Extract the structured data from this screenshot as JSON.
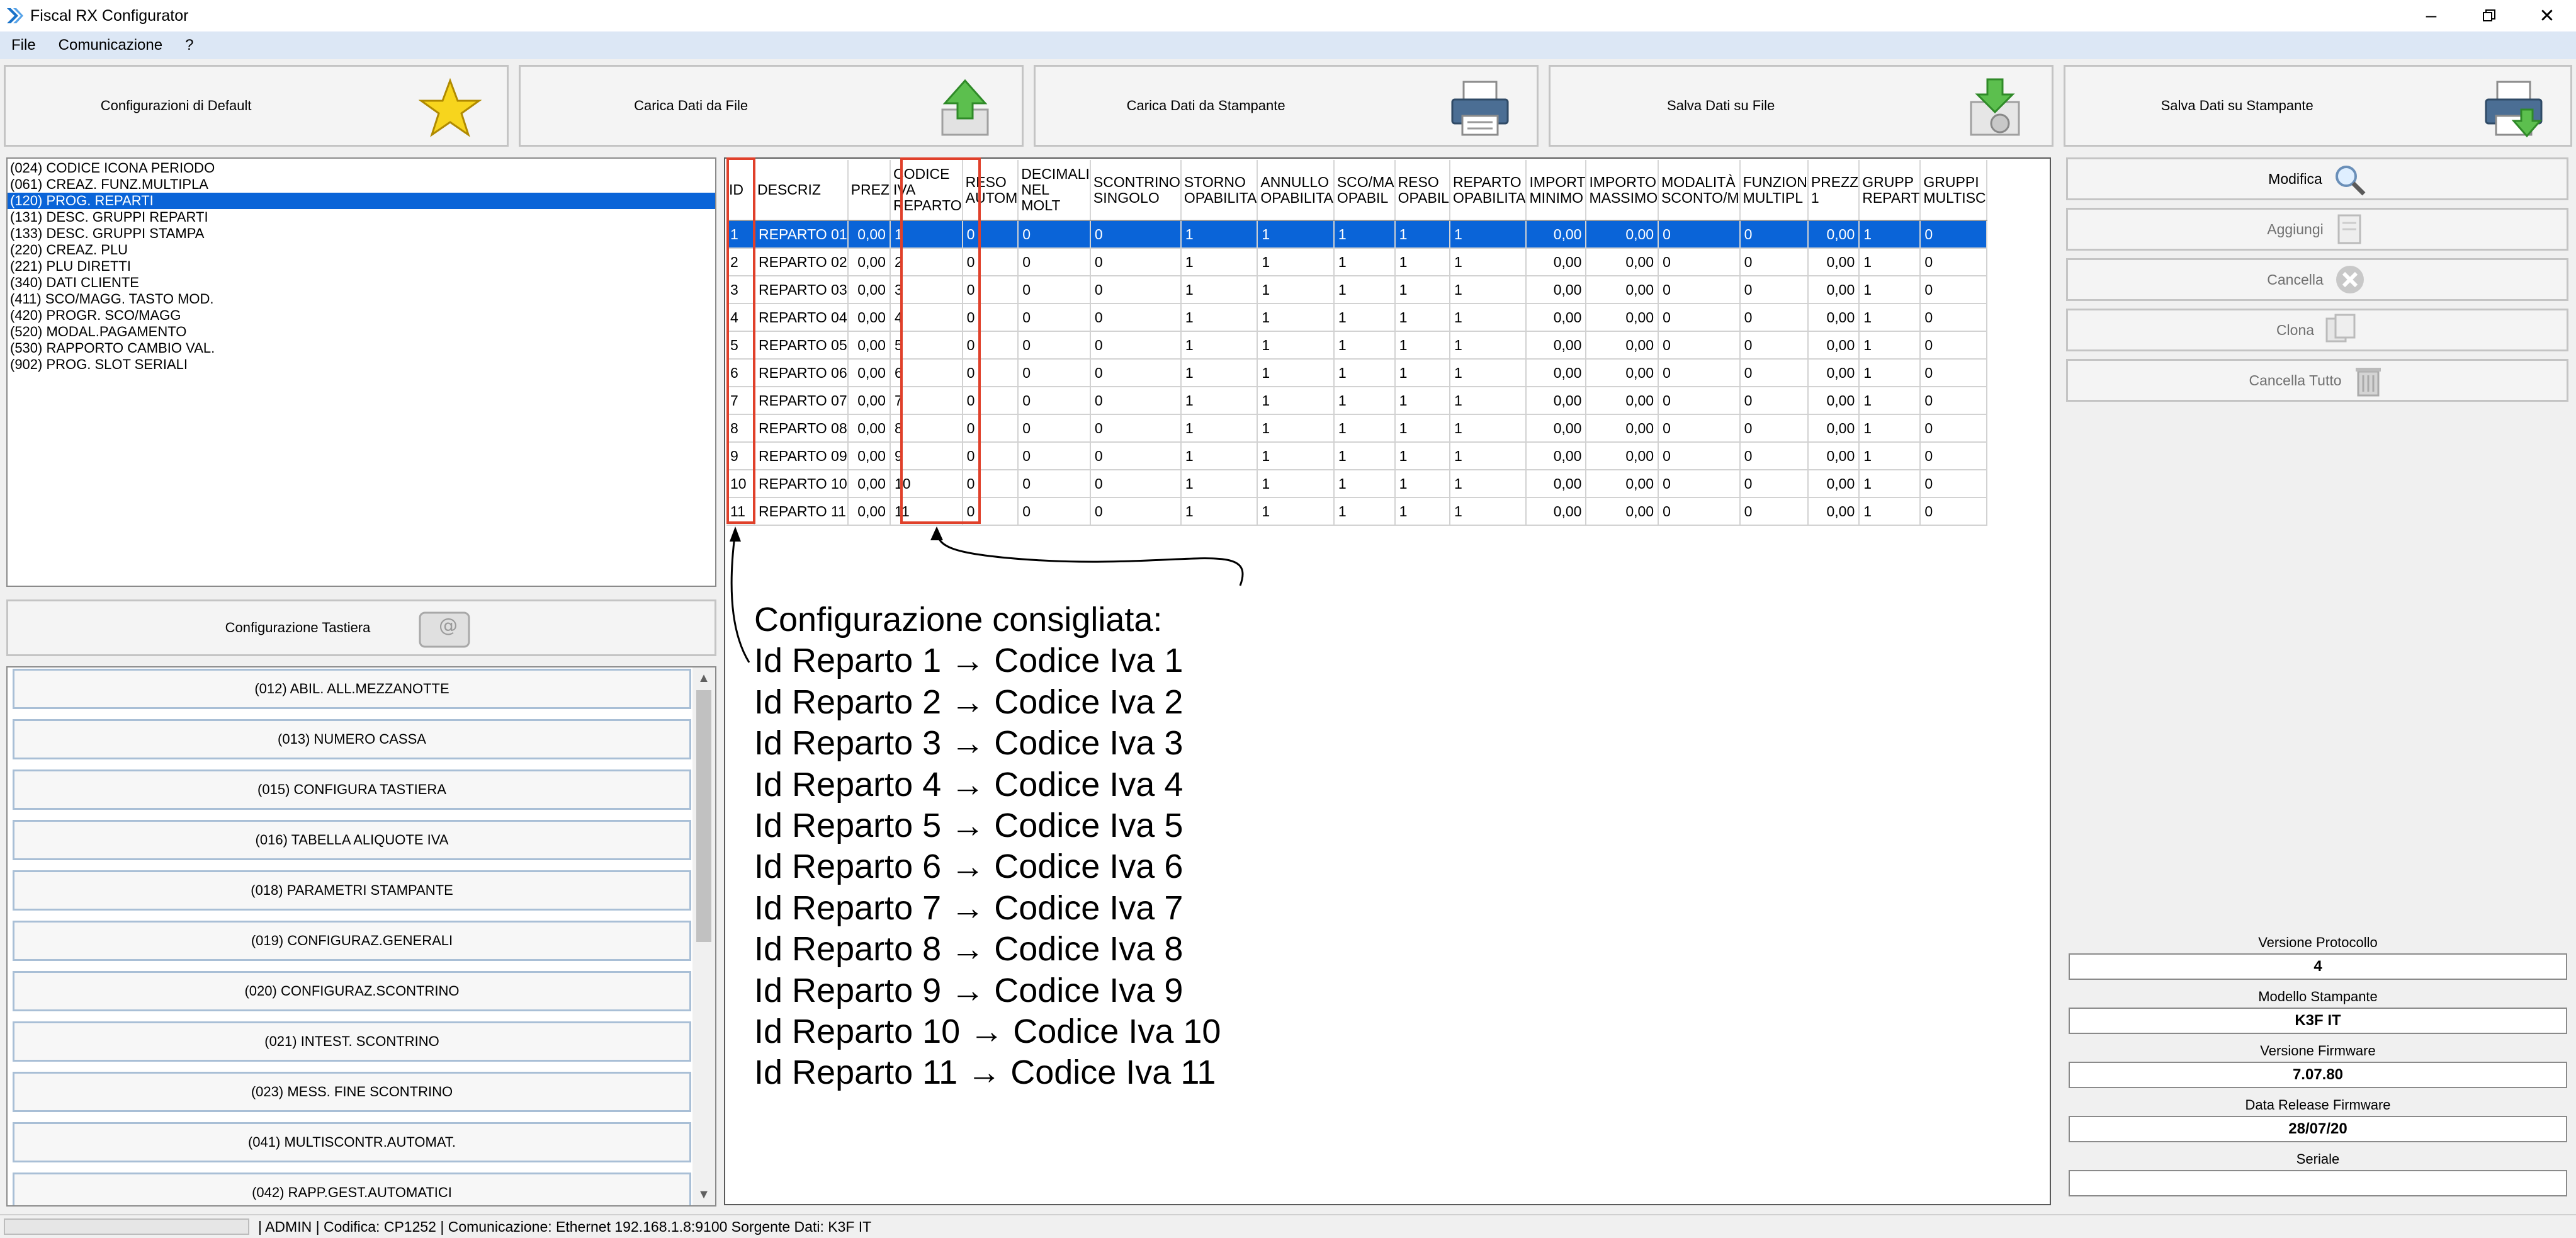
{
  "window": {
    "title": "Fiscal RX Configurator"
  },
  "menu": [
    "File",
    "Comunicazione",
    "?"
  ],
  "toolbar": [
    {
      "label": "Configurazioni di Default",
      "icon": "star-icon"
    },
    {
      "label": "Carica Dati da File",
      "icon": "upload-arrow-icon"
    },
    {
      "label": "Carica Dati da Stampante",
      "icon": "printer-icon"
    },
    {
      "label": "Salva Dati su File",
      "icon": "save-file-icon"
    },
    {
      "label": "Salva Dati su Stampante",
      "icon": "printer-save-icon"
    }
  ],
  "params_list": {
    "items": [
      "(024) CODICE ICONA PERIODO",
      "(061) CREAZ. FUNZ.MULTIPLA",
      "(120) PROG. REPARTI",
      "(131) DESC. GRUPPI REPARTI",
      "(133) DESC. GRUPPI STAMPA",
      "(220) CREAZ. PLU",
      "(221) PLU DIRETTI",
      "(340) DATI CLIENTE",
      "(411) SCO/MAGG. TASTO MOD.",
      "(420) PROGR. SCO/MAGG",
      "(520) MODAL.PAGAMENTO",
      "(530) RAPPORTO CAMBIO VAL.",
      "(902) PROG. SLOT SERIALI"
    ],
    "selected_index": 2
  },
  "keyboard_config": {
    "label": "Configurazione Tastiera",
    "items": [
      "(012) ABIL. ALL.MEZZANOTTE",
      "(013) NUMERO CASSA",
      "(015) CONFIGURA TASTIERA",
      "(016) TABELLA ALIQUOTE IVA",
      "(018) PARAMETRI STAMPANTE",
      "(019) CONFIGURAZ.GENERALI",
      "(020) CONFIGURAZ.SCONTRINO",
      "(021) INTEST. SCONTRINO",
      "(023) MESS. FINE SCONTRINO",
      "(041) MULTISCONTR.AUTOMAT.",
      "(042) RAPP.GEST.AUTOMATICI"
    ]
  },
  "grid": {
    "columns": [
      "ID",
      "DESCRIZ",
      "PREZ",
      "CODICE\nIVA\nREPARTO",
      "RESO\nAUTOM",
      "DECIMALI\nNEL MOLT",
      "SCONTRINO\nSINGOLO",
      "STORNO\nOPABILITA",
      "ANNULLO\nOPABILITA",
      "SCO/MA\nOPABIL",
      "RESO\nOPABIL",
      "REPARTO\nOPABILITA",
      "IMPORT\nMINIMO",
      "IMPORTO\nMASSIMO",
      "MODALITÀ\nSCONTO/M",
      "FUNZION\nMULTIPL",
      "PREZZ\n1",
      "GRUPP\nREPART",
      "GRUPPI\nMULTISC"
    ],
    "rows": [
      [
        "1",
        "REPARTO 01",
        "0,00",
        "1",
        "0",
        "0",
        "0",
        "1",
        "1",
        "1",
        "1",
        "1",
        "0,00",
        "0,00",
        "0",
        "0",
        "0,00",
        "1",
        "0"
      ],
      [
        "2",
        "REPARTO 02",
        "0,00",
        "2",
        "0",
        "0",
        "0",
        "1",
        "1",
        "1",
        "1",
        "1",
        "0,00",
        "0,00",
        "0",
        "0",
        "0,00",
        "1",
        "0"
      ],
      [
        "3",
        "REPARTO 03",
        "0,00",
        "3",
        "0",
        "0",
        "0",
        "1",
        "1",
        "1",
        "1",
        "1",
        "0,00",
        "0,00",
        "0",
        "0",
        "0,00",
        "1",
        "0"
      ],
      [
        "4",
        "REPARTO 04",
        "0,00",
        "4",
        "0",
        "0",
        "0",
        "1",
        "1",
        "1",
        "1",
        "1",
        "0,00",
        "0,00",
        "0",
        "0",
        "0,00",
        "1",
        "0"
      ],
      [
        "5",
        "REPARTO 05",
        "0,00",
        "5",
        "0",
        "0",
        "0",
        "1",
        "1",
        "1",
        "1",
        "1",
        "0,00",
        "0,00",
        "0",
        "0",
        "0,00",
        "1",
        "0"
      ],
      [
        "6",
        "REPARTO 06",
        "0,00",
        "6",
        "0",
        "0",
        "0",
        "1",
        "1",
        "1",
        "1",
        "1",
        "0,00",
        "0,00",
        "0",
        "0",
        "0,00",
        "1",
        "0"
      ],
      [
        "7",
        "REPARTO 07",
        "0,00",
        "7",
        "0",
        "0",
        "0",
        "1",
        "1",
        "1",
        "1",
        "1",
        "0,00",
        "0,00",
        "0",
        "0",
        "0,00",
        "1",
        "0"
      ],
      [
        "8",
        "REPARTO 08",
        "0,00",
        "8",
        "0",
        "0",
        "0",
        "1",
        "1",
        "1",
        "1",
        "1",
        "0,00",
        "0,00",
        "0",
        "0",
        "0,00",
        "1",
        "0"
      ],
      [
        "9",
        "REPARTO 09",
        "0,00",
        "9",
        "0",
        "0",
        "0",
        "1",
        "1",
        "1",
        "1",
        "1",
        "0,00",
        "0,00",
        "0",
        "0",
        "0,00",
        "1",
        "0"
      ],
      [
        "10",
        "REPARTO 10",
        "0,00",
        "10",
        "0",
        "0",
        "0",
        "1",
        "1",
        "1",
        "1",
        "1",
        "0,00",
        "0,00",
        "0",
        "0",
        "0,00",
        "1",
        "0"
      ],
      [
        "11",
        "REPARTO 11",
        "0,00",
        "11",
        "0",
        "0",
        "0",
        "1",
        "1",
        "1",
        "1",
        "1",
        "0,00",
        "0,00",
        "0",
        "0",
        "0,00",
        "1",
        "0"
      ]
    ],
    "selected_row": 0
  },
  "annotation": {
    "title": "Configurazione consigliata:",
    "lines": [
      "Id Reparto 1  → Codice Iva 1",
      "Id Reparto 2  → Codice Iva 2",
      "Id Reparto 3  → Codice Iva 3",
      "Id Reparto 4  → Codice Iva 4",
      "Id Reparto 5  → Codice Iva 5",
      "Id Reparto 6  → Codice Iva 6",
      "Id Reparto 7  → Codice Iva 7",
      "Id Reparto 8  → Codice Iva 8",
      "Id Reparto 9  → Codice Iva 9",
      "Id Reparto 10 → Codice Iva 10",
      "Id Reparto 11 → Codice Iva 11"
    ],
    "highlight_color": "#e0402a"
  },
  "actions": [
    {
      "label": "Modifica",
      "icon": "magnifier-icon",
      "enabled": true
    },
    {
      "label": "Aggiungi",
      "icon": "add-doc-icon",
      "enabled": false
    },
    {
      "label": "Cancella",
      "icon": "delete-x-icon",
      "enabled": false
    },
    {
      "label": "Clona",
      "icon": "clone-icon",
      "enabled": false
    },
    {
      "label": "Cancella Tutto",
      "icon": "trash-icon",
      "enabled": false
    }
  ],
  "info": [
    {
      "label": "Versione Protocollo",
      "value": "4"
    },
    {
      "label": "Modello Stampante",
      "value": "K3F IT"
    },
    {
      "label": "Versione Firmware",
      "value": "7.07.80"
    },
    {
      "label": "Data Release Firmware",
      "value": "28/07/20"
    },
    {
      "label": "Seriale",
      "value": ""
    }
  ],
  "status": {
    "text": "|  ADMIN  |  Codifica: CP1252  |  Comunicazione: Ethernet 192.168.1.8:9100   Sorgente Dati: K3F IT"
  },
  "colors": {
    "selection": "#0a64d8",
    "menubar": "#dce7f5",
    "accent_red": "#e0402a"
  }
}
